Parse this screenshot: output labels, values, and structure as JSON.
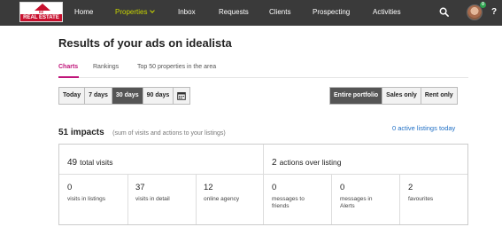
{
  "nav": {
    "logo_top": "RE",
    "logo_text": "REAL ESTATE",
    "items": [
      {
        "label": "Home"
      },
      {
        "label": "Properties"
      },
      {
        "label": "Inbox"
      },
      {
        "label": "Requests"
      },
      {
        "label": "Clients"
      },
      {
        "label": "Prospecting"
      },
      {
        "label": "Activities"
      }
    ],
    "active_item": "Properties",
    "notification_count": "0",
    "help": "?",
    "icons": [
      "search-icon",
      "avatar",
      "help-icon"
    ],
    "accent_color": "#c8d400",
    "background_color": "#3a3a3a"
  },
  "page": {
    "title": "Results of your ads on idealista"
  },
  "tabs": [
    {
      "label": "Charts",
      "active": true
    },
    {
      "label": "Rankings",
      "active": false
    },
    {
      "label": "Top 50 properties in the area",
      "active": false
    }
  ],
  "tab_accent_color": "#c0157a",
  "periods": [
    {
      "label": "Today",
      "active": false
    },
    {
      "label": "7 days",
      "active": false
    },
    {
      "label": "30 days",
      "active": true
    },
    {
      "label": "90 days",
      "active": false
    }
  ],
  "scope": [
    {
      "label": "Entire portfolio",
      "active": true
    },
    {
      "label": "Sales only",
      "active": false
    },
    {
      "label": "Rent only",
      "active": false
    }
  ],
  "impacts": {
    "count": "51 impacts",
    "note": "(sum of visits and actions to your listings)",
    "active_listings_link": "0 active listings today"
  },
  "stats": {
    "visits": {
      "total": "49",
      "label": "total visits",
      "cells": [
        {
          "value": "0",
          "label": "visits in listings"
        },
        {
          "value": "37",
          "label": "visits in detail"
        },
        {
          "value": "12",
          "label": "online agency"
        }
      ]
    },
    "actions": {
      "total": "2",
      "label": "actions over listing",
      "cells": [
        {
          "value": "0",
          "label": "messages to friends"
        },
        {
          "value": "0",
          "label": "messages in Alerts"
        },
        {
          "value": "2",
          "label": "favourites"
        }
      ]
    }
  }
}
